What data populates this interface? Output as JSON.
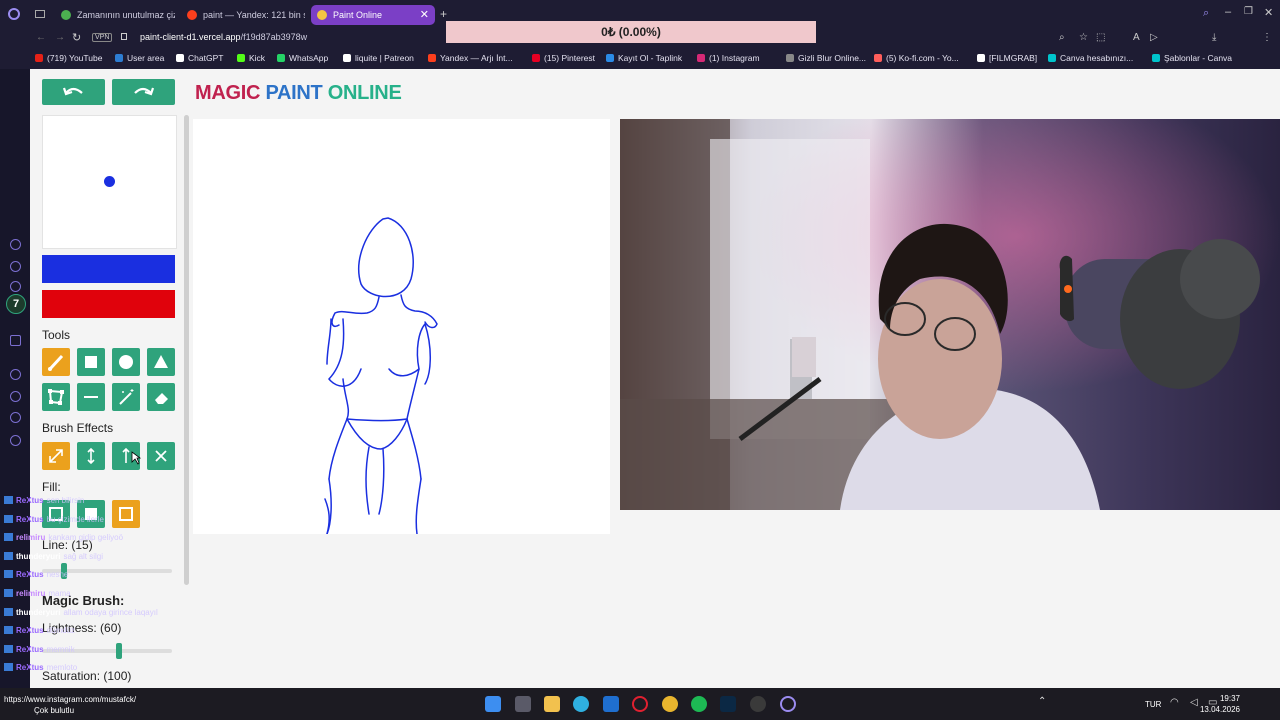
{
  "tabs": [
    {
      "label": "Zamanının unutulmaz çizgi..."
    },
    {
      "label": "paint — Yandex: 121 bin sonuç"
    },
    {
      "label": "Paint Online"
    }
  ],
  "address": {
    "url_host": "paint-client-d1.vercel.app",
    "url_path": "/f19d87ab3978w",
    "vpn": "VPN"
  },
  "progress_text": "0₺ (0.00%)",
  "bookmarks": [
    {
      "label": "(719) YouTube",
      "color": "#e62117"
    },
    {
      "label": "User area",
      "color": "#2d7dd2"
    },
    {
      "label": "ChatGPT",
      "color": "#ffffff"
    },
    {
      "label": "Kick",
      "color": "#53fc18"
    },
    {
      "label": "WhatsApp",
      "color": "#25d366"
    },
    {
      "label": "liquite | Patreon",
      "color": "#ffffff"
    },
    {
      "label": "Yandex — Arjı İnt...",
      "color": "#fc3f1d"
    },
    {
      "label": "(15) Pinterest",
      "color": "#e60023"
    },
    {
      "label": "Kayıt Ol - Taplink",
      "color": "#2b8be6"
    },
    {
      "label": "(1) Instagram",
      "color": "#d62976"
    },
    {
      "label": "Gizli Blur Online...",
      "color": "#888888"
    },
    {
      "label": "(5) Ko-fi.com - Yo...",
      "color": "#ff5e5b"
    },
    {
      "label": "[FILMGRAB]",
      "color": "#ffffff"
    },
    {
      "label": "Canva hesabınızı...",
      "color": "#00c4cc"
    },
    {
      "label": "Şablonlar - Canva",
      "color": "#00c4cc"
    }
  ],
  "app": {
    "title_magic": "MAGIC",
    "title_paint": "PAINT",
    "title_online": "ONLINE",
    "tools_label": "Tools",
    "brush_effects_label": "Brush Effects",
    "fill_label": "Fill:",
    "line_label": "Line: (15)",
    "magic_brush_label": "Magic Brush:",
    "lightness_label": "Lightness: (60)",
    "saturation_label": "Saturation: (100)",
    "primary_color": "#1a2fe0",
    "secondary_color": "#e0020c",
    "accent": "#2fa37c",
    "line_value": 15,
    "line_max": 100,
    "lightness_value": 60,
    "lightness_max": 100
  },
  "chat": [
    {
      "user": "ReXtus",
      "msg": "sen bilirsin"
    },
    {
      "user": "ReXtus",
      "msg": "bu çizimde ilerle"
    },
    {
      "user": "relimiru",
      "msg": "kankam gidip geliyoö"
    },
    {
      "user": "thunderyuri",
      "msg": "sağ alt silgi"
    },
    {
      "user": "ReXtus",
      "msg": "nesne"
    },
    {
      "user": "relimiru",
      "msg": "mama"
    },
    {
      "user": "thunderyuri",
      "msg": "allam odaya girince laqayıl"
    },
    {
      "user": "ReXtus",
      "msg": "dümdüz"
    },
    {
      "user": "ReXtus",
      "msg": "memnik"
    },
    {
      "user": "ReXtus",
      "msg": "memloto"
    }
  ],
  "status": {
    "url_line": "https://www.instagram.com/mustafck/",
    "sub_line": "Çok bulutlu"
  },
  "taskbar": {
    "lang": "TUR",
    "time": "19:37",
    "date": "13.04.2026"
  }
}
